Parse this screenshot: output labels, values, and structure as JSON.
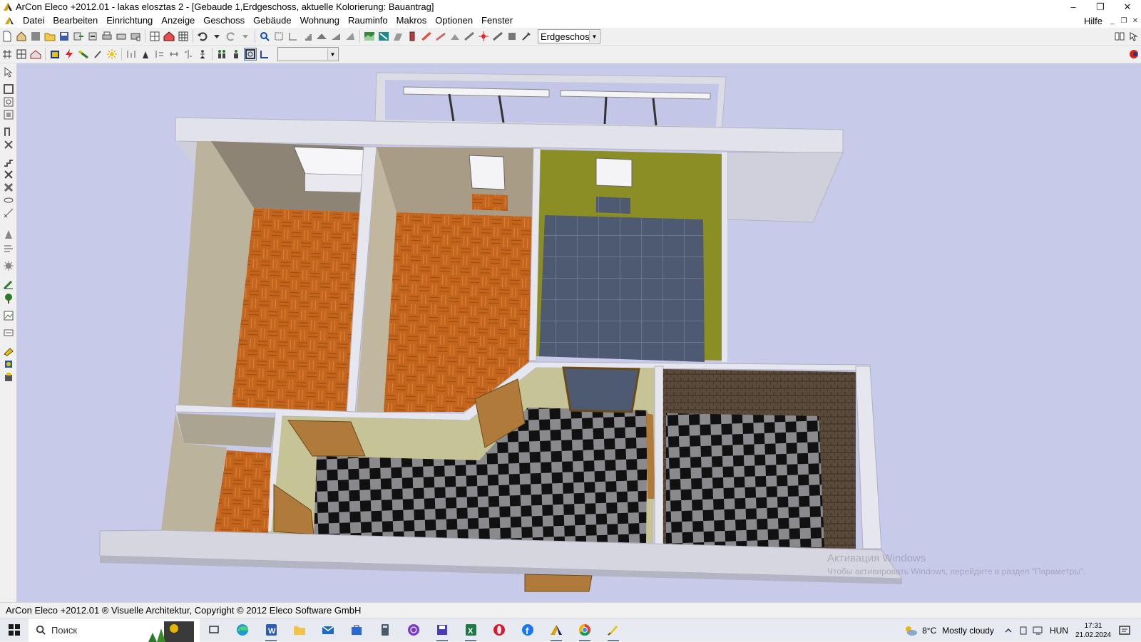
{
  "window": {
    "title": "ArCon Eleco  +2012.01  - lakas elosztas 2 - [Gebaude 1,Erdgeschoss, aktuelle Kolorierung: Bauantrag]",
    "minimize": "–",
    "restore": "❐",
    "close": "✕"
  },
  "menu": {
    "items": [
      "Datei",
      "Bearbeiten",
      "Einrichtung",
      "Anzeige",
      "Geschoss",
      "Gebäude",
      "Wohnung",
      "Rauminfo",
      "Makros",
      "Optionen",
      "Fenster"
    ],
    "help": "Hilfe"
  },
  "toolbar": {
    "floor_select": "Erdgeschoss",
    "second_select": ""
  },
  "viewport": {
    "watermark_title": "Активация Windows",
    "watermark_text": "Чтобы активировать Windows, перейдите в раздел \"Параметры\"."
  },
  "status": {
    "text": "ArCon Eleco +2012.01 ® Visuelle Architektur, Copyright © 2012 Eleco Software GmbH"
  },
  "taskbar": {
    "search_placeholder": "Поиск",
    "weather_temp": "8°C",
    "weather_desc": "Mostly cloudy",
    "language": "HUN",
    "time": "17:31",
    "date": "21.02.2024"
  },
  "colors": {
    "viewport_bg": "#c8cae9",
    "olive_wall": "#8b8d25",
    "parquet": "#c4651e",
    "wall_top": "#d4d4de"
  }
}
